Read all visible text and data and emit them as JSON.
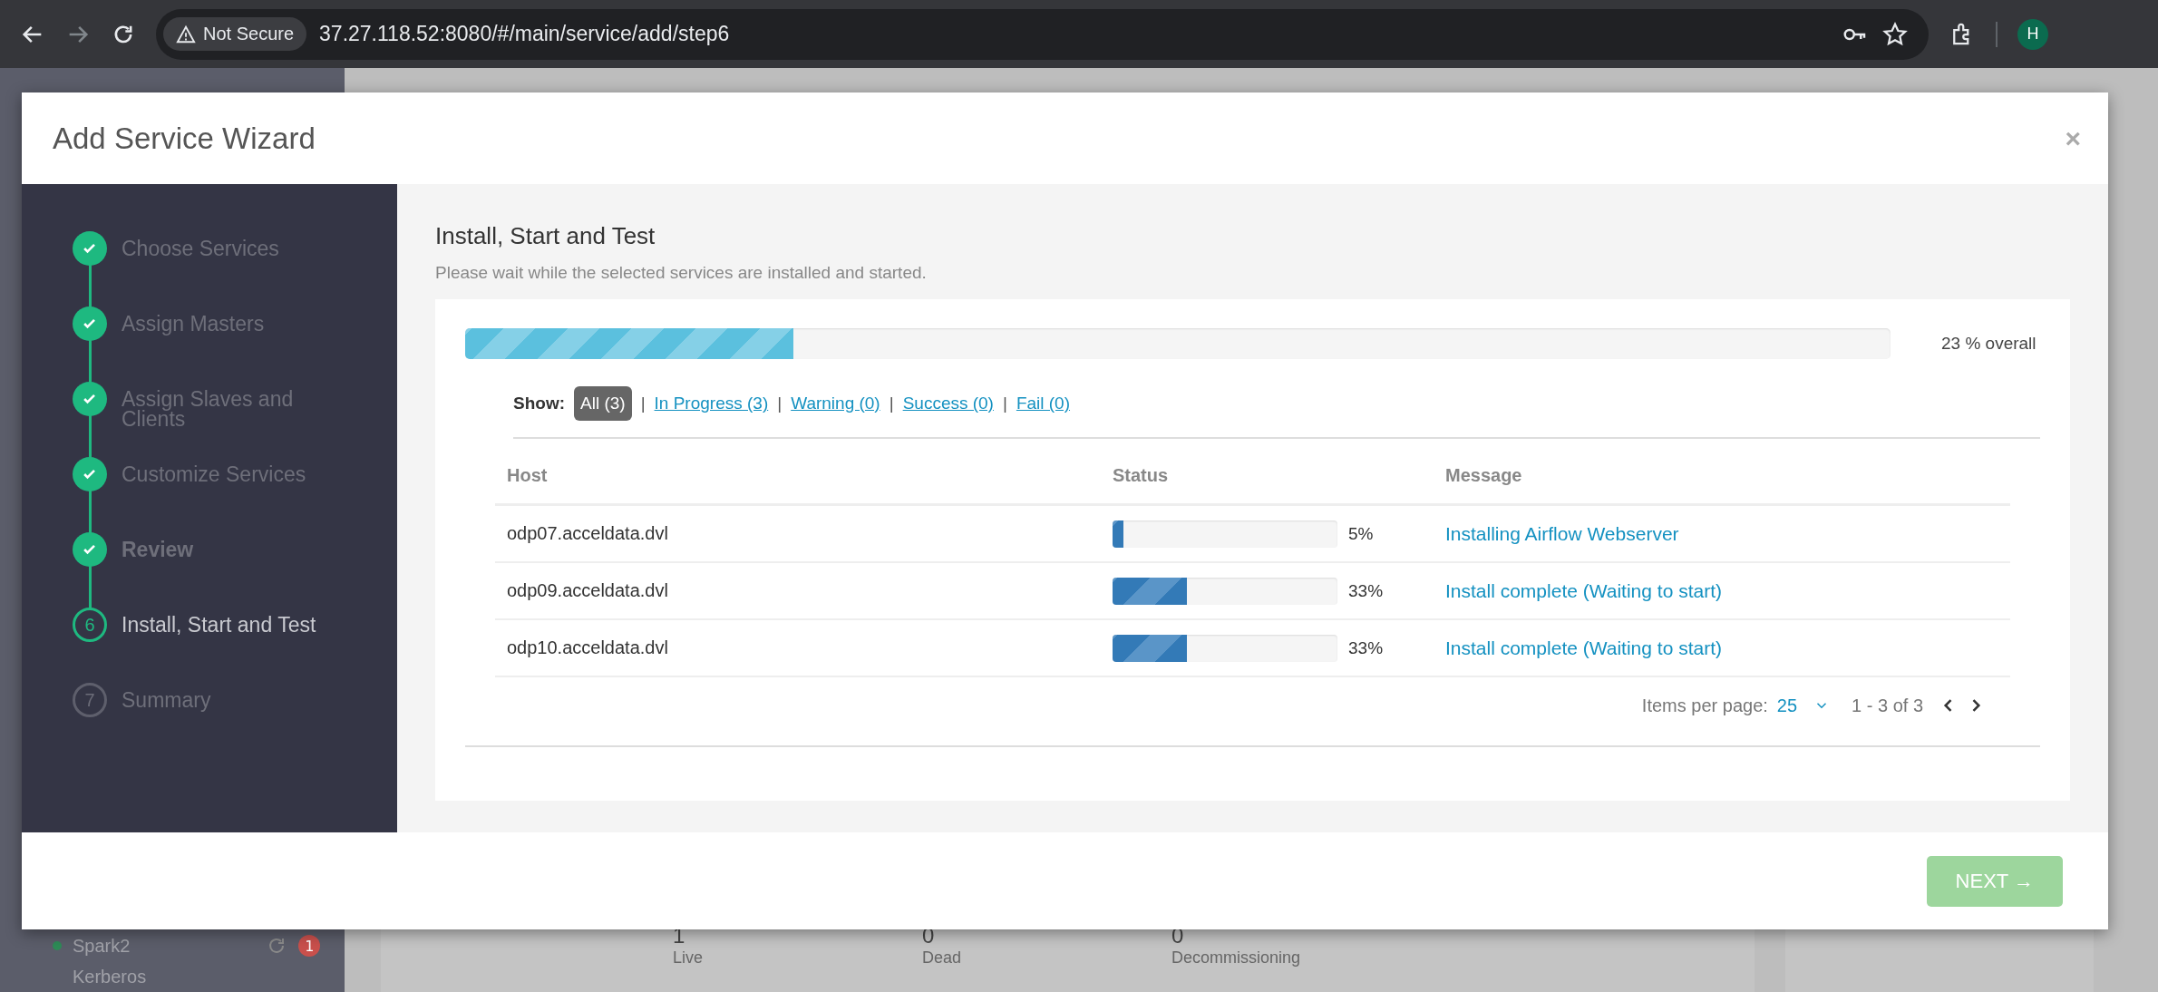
{
  "browser": {
    "security_label": "Not Secure",
    "url": "37.27.118.52:8080/#/main/service/add/step6",
    "profile_initial": "H"
  },
  "background": {
    "nav_items": [
      {
        "name": "Spark2",
        "color": "#2e8b57",
        "alert_count": "1"
      },
      {
        "name": "Kerberos"
      }
    ],
    "metrics": [
      {
        "value": "1",
        "label": "Live"
      },
      {
        "value": "0",
        "label": "Dead"
      },
      {
        "value": "0",
        "label": "Decommissioning"
      }
    ]
  },
  "modal": {
    "title": "Add Service Wizard",
    "close": "×",
    "steps": [
      {
        "label": "Choose Services",
        "completed": true,
        "active": false,
        "bold": false
      },
      {
        "label": "Assign Masters",
        "completed": true,
        "active": false,
        "bold": false
      },
      {
        "label": "Assign Slaves and Clients",
        "completed": true,
        "active": false,
        "bold": false
      },
      {
        "label": "Customize Services",
        "completed": true,
        "active": false,
        "bold": false
      },
      {
        "label": "Review",
        "completed": true,
        "active": false,
        "bold": true
      },
      {
        "label": "Install, Start and Test",
        "completed": false,
        "active": true,
        "number": "6",
        "bold": false
      },
      {
        "label": "Summary",
        "completed": false,
        "active": false,
        "number": "7",
        "bold": false
      }
    ],
    "heading": "Install, Start and Test",
    "subtitle": "Please wait while the selected services are installed and started.",
    "overall": {
      "level": 0.23,
      "reading": "23 % overall"
    },
    "show_label": "Show:",
    "filter_separator": "|",
    "filters": [
      {
        "label": "All (3)",
        "selected": true
      },
      {
        "label": "In Progress (3)",
        "selected": false
      },
      {
        "label": "Warning (0)",
        "selected": false
      },
      {
        "label": "Success (0)",
        "selected": false
      },
      {
        "label": "Fail (0)",
        "selected": false
      }
    ],
    "table": {
      "columns": [
        "Host",
        "Status",
        "Message"
      ],
      "rows": [
        {
          "host": "odp07.acceldata.dvl",
          "level": 0.05,
          "reading": "5%",
          "message": "Installing Airflow Webserver"
        },
        {
          "host": "odp09.acceldata.dvl",
          "level": 0.33,
          "reading": "33%",
          "message": "Install complete (Waiting to start)"
        },
        {
          "host": "odp10.acceldata.dvl",
          "level": 0.33,
          "reading": "33%",
          "message": "Install complete (Waiting to start)"
        }
      ]
    },
    "pagination": {
      "label": "Items per page:",
      "value": "25",
      "range": "1 - 3 of 3"
    },
    "next_button": {
      "label": "NEXT →",
      "disabled": true
    }
  }
}
